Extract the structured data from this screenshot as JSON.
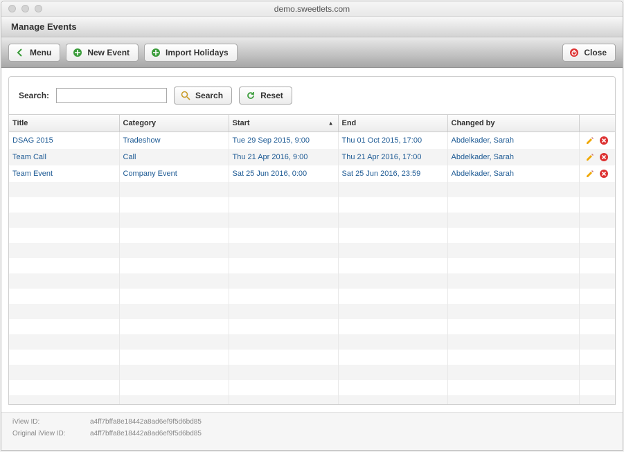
{
  "window": {
    "title": "demo.sweetlets.com"
  },
  "header": {
    "title": "Manage Events"
  },
  "toolbar": {
    "menu_label": "Menu",
    "new_event_label": "New Event",
    "import_holidays_label": "Import Holidays",
    "close_label": "Close"
  },
  "search": {
    "label": "Search:",
    "value": "",
    "search_button": "Search",
    "reset_button": "Reset"
  },
  "table": {
    "columns": {
      "title": "Title",
      "category": "Category",
      "start": "Start",
      "end": "End",
      "changed_by": "Changed by"
    },
    "sort_column": "start",
    "sort_direction": "asc",
    "rows": [
      {
        "title": "DSAG 2015",
        "category": "Tradeshow",
        "start": "Tue 29 Sep 2015, 9:00",
        "end": "Thu 01 Oct 2015, 17:00",
        "changed_by": "Abdelkader, Sarah"
      },
      {
        "title": "Team Call",
        "category": "Call",
        "start": "Thu 21 Apr 2016, 9:00",
        "end": "Thu 21 Apr 2016, 17:00",
        "changed_by": "Abdelkader, Sarah"
      },
      {
        "title": "Team Event",
        "category": "Company Event",
        "start": "Sat 25 Jun 2016, 0:00",
        "end": "Sat 25 Jun 2016, 23:59",
        "changed_by": "Abdelkader, Sarah"
      }
    ],
    "empty_rows": 15
  },
  "footer": {
    "iview_id_label": "iView ID:",
    "iview_id_value": "a4ff7bffa8e18442a8ad6ef9f5d6bd85",
    "original_iview_id_label": "Original iView ID:",
    "original_iview_id_value": "a4ff7bffa8e18442a8ad6ef9f5d6bd85"
  }
}
